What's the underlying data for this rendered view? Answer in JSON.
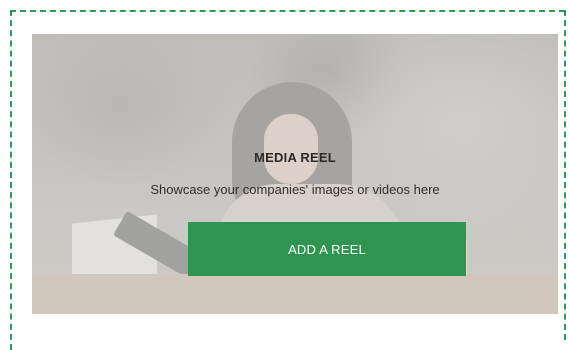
{
  "media_reel": {
    "title": "MEDIA REEL",
    "subtitle": "Showcase your companies' images or videos here",
    "button_label": "ADD A REEL"
  },
  "colors": {
    "accent_green": "#2e944f",
    "dashed_border": "#2e9a5a"
  }
}
